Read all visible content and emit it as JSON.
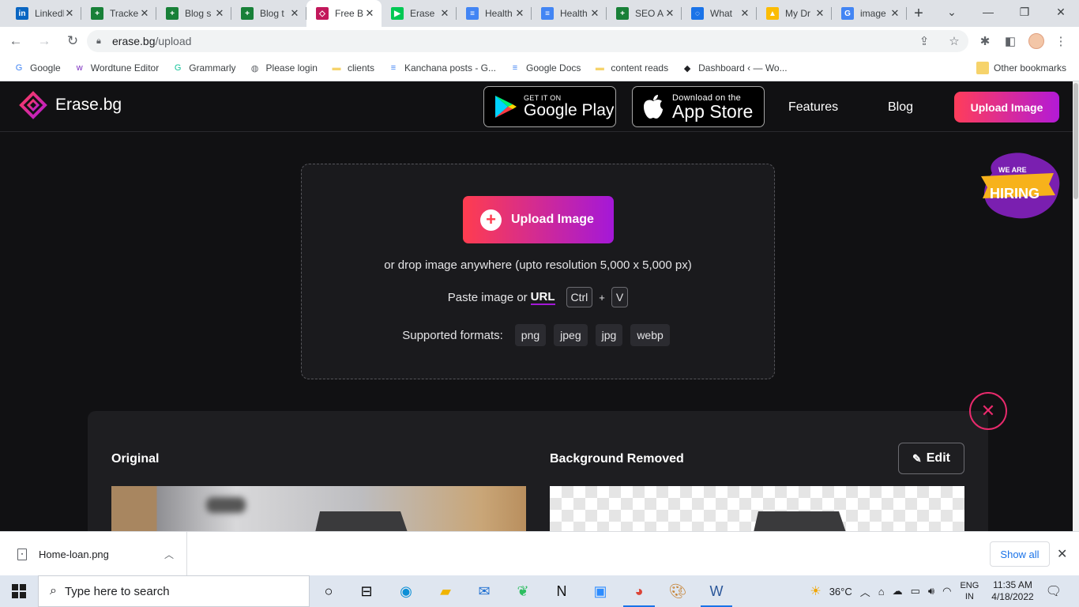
{
  "browser": {
    "tabs": [
      {
        "title": "LinkedIn",
        "icon": "linkedin-icon",
        "color": "#0a66c2",
        "glyph": "in"
      },
      {
        "title": "Tracker",
        "icon": "sheets-icon",
        "color": "#188038",
        "glyph": "+"
      },
      {
        "title": "Blog s",
        "icon": "sheets-icon",
        "color": "#188038",
        "glyph": "+"
      },
      {
        "title": "Blog t",
        "icon": "sheets-icon",
        "color": "#188038",
        "glyph": "+"
      },
      {
        "title": "Free B",
        "icon": "erase-bg-icon",
        "color": "#c2185b",
        "glyph": "◇",
        "active": true
      },
      {
        "title": "Erase",
        "icon": "play-store-icon",
        "color": "#00c853",
        "glyph": "▶"
      },
      {
        "title": "Health",
        "icon": "docs-icon",
        "color": "#4285f4",
        "glyph": "≡"
      },
      {
        "title": "Health",
        "icon": "docs-icon",
        "color": "#4285f4",
        "glyph": "≡"
      },
      {
        "title": "SEO A",
        "icon": "sheets-icon",
        "color": "#188038",
        "glyph": "+"
      },
      {
        "title": "What",
        "icon": "loading-icon",
        "color": "#1a73e8",
        "glyph": "◌"
      },
      {
        "title": "My Dr",
        "icon": "drive-icon",
        "color": "#fbbc04",
        "glyph": "▲"
      },
      {
        "title": "image",
        "icon": "google-icon",
        "color": "#4285f4",
        "glyph": "G"
      }
    ],
    "url": {
      "host": "erase.bg",
      "path": "/upload"
    },
    "bookmarks": [
      {
        "label": "Google",
        "icon": "google-icon",
        "glyph": "G",
        "color": "#4285f4"
      },
      {
        "label": "Wordtune Editor",
        "icon": "wordtune-icon",
        "glyph": "w",
        "color": "#7b2cbf"
      },
      {
        "label": "Grammarly",
        "icon": "grammarly-icon",
        "glyph": "G",
        "color": "#15c39a"
      },
      {
        "label": "Please login",
        "icon": "globe-icon",
        "glyph": "◍",
        "color": "#5f6368"
      },
      {
        "label": "clients",
        "icon": "folder-icon",
        "glyph": "▬",
        "color": "#f6d36b"
      },
      {
        "label": "Kanchana posts - G...",
        "icon": "docs-icon",
        "glyph": "≡",
        "color": "#4285f4"
      },
      {
        "label": "Google Docs",
        "icon": "docs-icon",
        "glyph": "≡",
        "color": "#4285f4"
      },
      {
        "label": "content reads",
        "icon": "folder-icon",
        "glyph": "▬",
        "color": "#f6d36b"
      },
      {
        "label": "Dashboard ‹ — Wo...",
        "icon": "wordpress-icon",
        "glyph": "◆",
        "color": "#202124"
      }
    ],
    "other_bookmarks": "Other bookmarks"
  },
  "site": {
    "logo_text": "Erase.bg",
    "google_play": {
      "top": "GET IT ON",
      "bottom": "Google Play"
    },
    "app_store": {
      "top": "Download on the",
      "bottom": "App Store"
    },
    "nav": {
      "features": "Features",
      "blog": "Blog"
    },
    "header_upload": "Upload Image",
    "hiring": {
      "small": "WE ARE",
      "big": "HIRING"
    },
    "upload_button": "Upload Image",
    "drop_text": "or drop image anywhere (upto resolution 5,000 x 5,000 px)",
    "paste_text": "Paste image or",
    "url_word": "URL",
    "key_ctrl": "Ctrl",
    "key_plus": "+",
    "key_v": "V",
    "formats_label": "Supported formats:",
    "formats": [
      "png",
      "jpeg",
      "jpg",
      "webp"
    ],
    "original_label": "Original",
    "removed_label": "Background Removed",
    "edit_label": "Edit",
    "accent": "#ff3d5a",
    "accent2": "#b31ad6"
  },
  "downloads": {
    "file": "Home-loan.png",
    "show_all": "Show all"
  },
  "taskbar": {
    "search_placeholder": "Type here to search",
    "weather": "36°C",
    "lang_top": "ENG",
    "lang_bottom": "IN",
    "time": "11:35 AM",
    "date": "4/18/2022"
  }
}
